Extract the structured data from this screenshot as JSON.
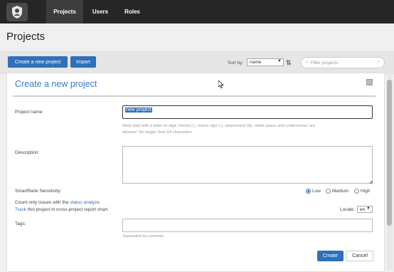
{
  "nav": {
    "items": [
      {
        "label": "Projects",
        "active": true
      },
      {
        "label": "Users",
        "active": false
      },
      {
        "label": "Roles",
        "active": false
      }
    ]
  },
  "page": {
    "title": "Projects"
  },
  "toolbar": {
    "create_label": "Create a new project",
    "import_label": "Import",
    "sort_by_label": "Sort by",
    "sort_value": "name",
    "filter_placeholder": "Filter projects"
  },
  "dialog": {
    "title": "Create a new project",
    "project_name_label": "Project name:",
    "project_name_value": "new project",
    "project_name_help_1": "Must start with a letter or digit. Period (.), minus sign (-), ampersand (&), white space and underscores are",
    "project_name_help_2": "allowed. No longer than 64 characters.",
    "description_label": "Description:",
    "smartrank_label": "SmartRank Sensitivity:",
    "smartrank_options": [
      "Low",
      "Medium",
      "High"
    ],
    "smartrank_selected": "Low",
    "count_text_pre": "Count only issues with the",
    "count_text_link": "status analyze.",
    "track_link": "Track",
    "track_text_post": "this project in cross-project report chart.",
    "locale_label": "Locale:",
    "locale_value": "en",
    "tags_label": "Tags:",
    "tags_help": "Separated by commas",
    "create_button": "Create",
    "cancel_button": "Cancel"
  },
  "colors": {
    "accent": "#2f6fbb",
    "title_blue": "#3a7cc4",
    "topbar": "#262626"
  }
}
